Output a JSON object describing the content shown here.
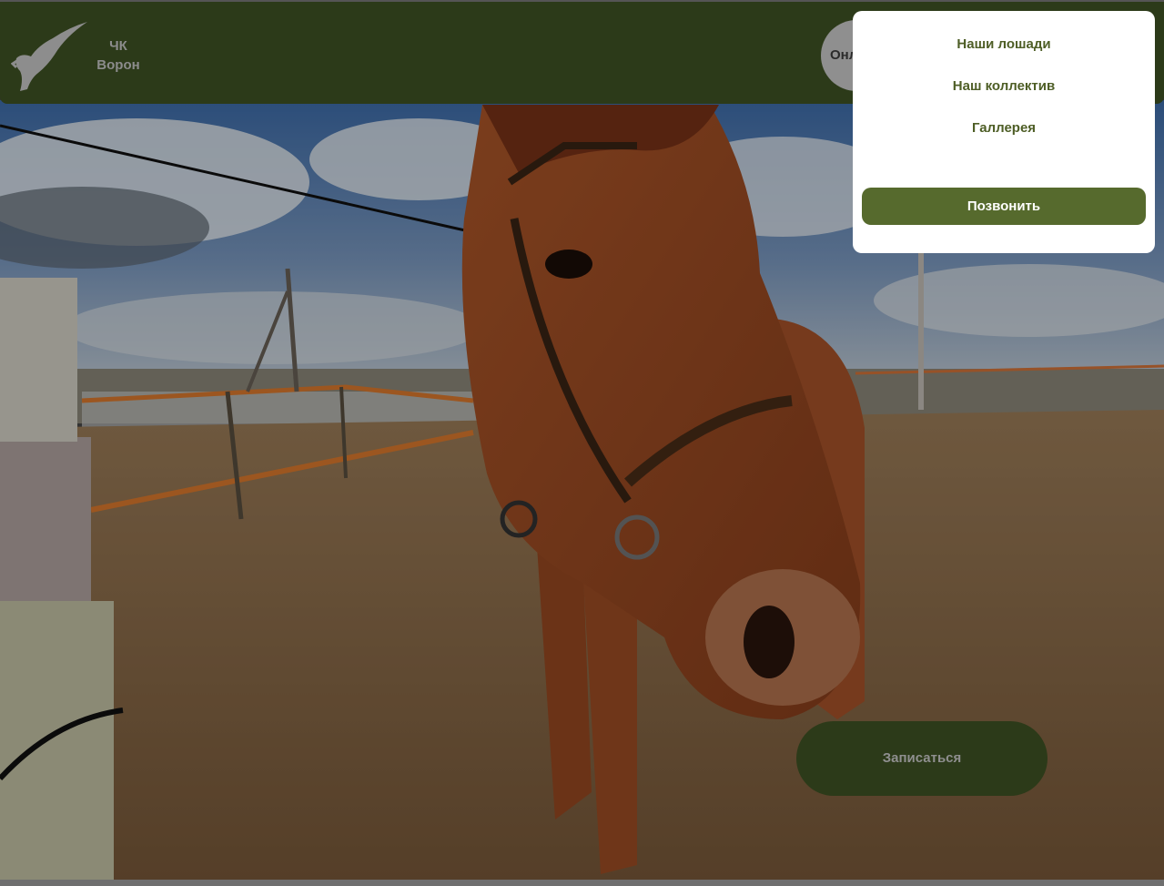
{
  "header": {
    "brand_line1": "ЧК",
    "brand_line2": "Ворон",
    "online_button": "Онлайн"
  },
  "menu": {
    "items": [
      {
        "label": "Наши лошади"
      },
      {
        "label": "Наш коллектив"
      },
      {
        "label": "Галлерея"
      }
    ],
    "call_button": "Позвонить"
  },
  "hero": {
    "cta_label": "Записаться"
  },
  "colors": {
    "header_bg": "#2c3a19",
    "accent_green": "#566a2d",
    "menu_text": "#4e5e26",
    "menu_bg": "#ffffff"
  },
  "icons": {
    "logo": "pegasus-wing-logo"
  }
}
